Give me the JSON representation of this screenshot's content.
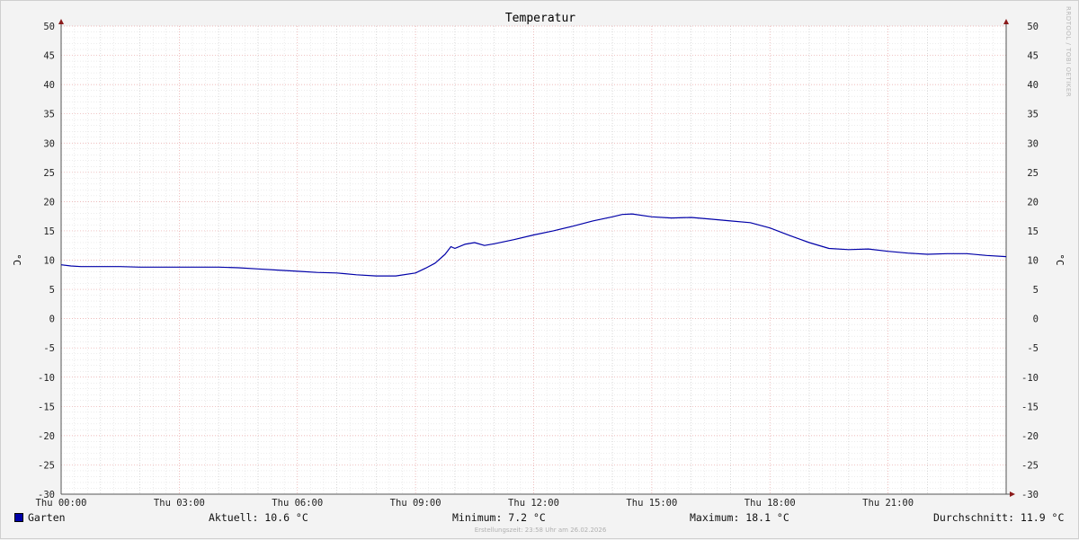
{
  "chart_data": {
    "type": "line",
    "title": "Temperatur",
    "ylabel": "°C",
    "ylabel_right": "°C",
    "ylim": [
      -30,
      50
    ],
    "yticks": [
      50,
      45,
      40,
      35,
      30,
      25,
      20,
      15,
      10,
      5,
      0,
      -5,
      -10,
      -15,
      -20,
      -25,
      -30
    ],
    "xlim_hours": [
      0,
      24
    ],
    "xticks": [
      {
        "h": 0,
        "label": "Thu 00:00"
      },
      {
        "h": 3,
        "label": "Thu 03:00"
      },
      {
        "h": 6,
        "label": "Thu 06:00"
      },
      {
        "h": 9,
        "label": "Thu 09:00"
      },
      {
        "h": 12,
        "label": "Thu 12:00"
      },
      {
        "h": 15,
        "label": "Thu 15:00"
      },
      {
        "h": 18,
        "label": "Thu 18:00"
      },
      {
        "h": 21,
        "label": "Thu 21:00"
      }
    ],
    "grid": true,
    "series": [
      {
        "name": "Garten",
        "color": "#0000a8",
        "x_hours": [
          0,
          0.25,
          0.5,
          1,
          1.5,
          2,
          2.5,
          3,
          3.5,
          4,
          4.5,
          5,
          5.5,
          6,
          6.5,
          7,
          7.5,
          8,
          8.5,
          9,
          9.25,
          9.5,
          9.75,
          9.9,
          10,
          10.25,
          10.5,
          10.75,
          11,
          11.5,
          12,
          12.5,
          13,
          13.5,
          14,
          14.25,
          14.5,
          15,
          15.5,
          16,
          16.5,
          17,
          17.5,
          18,
          18.5,
          19,
          19.5,
          20,
          20.5,
          21,
          21.5,
          22,
          22.5,
          23,
          23.5,
          24
        ],
        "values": [
          9.2,
          9.0,
          8.9,
          8.9,
          8.9,
          8.8,
          8.8,
          8.8,
          8.8,
          8.8,
          8.7,
          8.5,
          8.3,
          8.1,
          7.9,
          7.8,
          7.5,
          7.3,
          7.3,
          7.8,
          8.6,
          9.5,
          11.0,
          12.3,
          12.0,
          12.7,
          13.0,
          12.5,
          12.8,
          13.5,
          14.3,
          15.0,
          15.8,
          16.7,
          17.4,
          17.8,
          17.9,
          17.4,
          17.2,
          17.3,
          17.0,
          16.7,
          16.4,
          15.5,
          14.2,
          13.0,
          12.0,
          11.8,
          11.9,
          11.5,
          11.2,
          11.0,
          11.1,
          11.1,
          10.8,
          10.6
        ]
      }
    ]
  },
  "legend": {
    "series_name": "Garten",
    "current": "Aktuell: 10.6 °C",
    "minimum": "Minimum: 7.2 °C",
    "maximum": "Maximum: 18.1 °C",
    "average": "Durchschnitt: 11.9 °C"
  },
  "footer": "Erstellungszeit: 23:58 Uhr am 26.02.2026",
  "watermark": "RRDTOOL / TOBI OETIKER"
}
